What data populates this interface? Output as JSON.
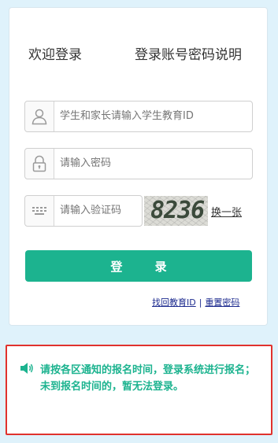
{
  "login": {
    "welcome": "欢迎登录",
    "help_link": "登录账号密码说明",
    "id_placeholder": "学生和家长请输入学生教育ID",
    "password_placeholder": "请输入密码",
    "captcha_placeholder": "请输入验证码",
    "captcha_code": "8236",
    "refresh_captcha": "换一张",
    "submit": "登 录",
    "recover_id": "找回教育ID",
    "separator": "|",
    "reset_password": "重置密码"
  },
  "notice": {
    "message": "请按各区通知的报名时间，登录系统进行报名；未到报名时间的，暂无法登录。"
  },
  "colors": {
    "accent": "#1cb38f",
    "alert_border": "#e0322d",
    "background": "#dff2fb"
  },
  "icons": {
    "id_field": "user-icon",
    "password_field": "lock-icon",
    "captcha_field": "keyboard-icon",
    "notice": "speaker-icon"
  }
}
